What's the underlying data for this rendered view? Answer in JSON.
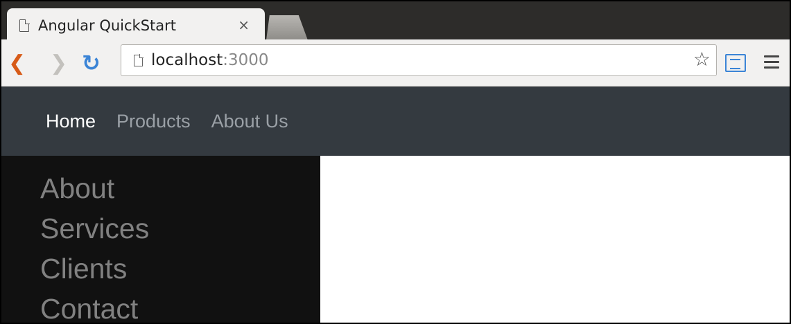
{
  "browser": {
    "tab": {
      "title": "Angular QuickStart",
      "close_glyph": "×"
    },
    "url": {
      "host": "localhost",
      "port": ":3000"
    },
    "icons": [
      "back-icon",
      "forward-icon",
      "reload-icon",
      "page-icon",
      "star-icon",
      "cast-icon",
      "menu-icon"
    ]
  },
  "navbar": {
    "links": [
      {
        "label": "Home",
        "active": true
      },
      {
        "label": "Products",
        "active": false
      },
      {
        "label": "About Us",
        "active": false
      }
    ]
  },
  "sidebar": {
    "links": [
      "About",
      "Services",
      "Clients",
      "Contact"
    ]
  },
  "colors": {
    "navbar_bg": "#343a40",
    "sidebar_bg": "#111111",
    "sidebar_link": "#818181",
    "nav_active": "#ffffff",
    "nav_muted": "#9aa0a6"
  }
}
